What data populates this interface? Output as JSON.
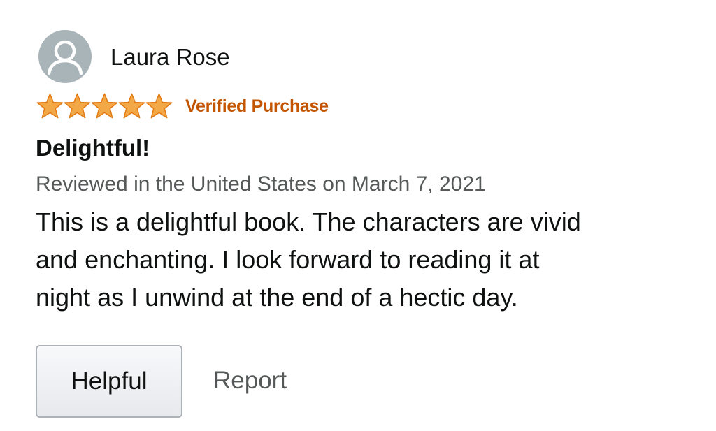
{
  "reviewer": {
    "name": "Laura Rose",
    "avatar_icon": "user-silhouette-icon"
  },
  "rating": {
    "stars": 5,
    "max": 5,
    "star_color": "#f3a847"
  },
  "badge": {
    "label": "Verified Purchase",
    "color": "#c45500"
  },
  "review": {
    "title": "Delightful!",
    "date_line": "Reviewed in the United States on March 7, 2021",
    "body_lines": [
      "This is a delightful book. The characters are vivid",
      "and enchanting. I look forward to reading it at",
      "night as I unwind at the end of a hectic day."
    ]
  },
  "actions": {
    "helpful_label": "Helpful",
    "report_label": "Report"
  }
}
